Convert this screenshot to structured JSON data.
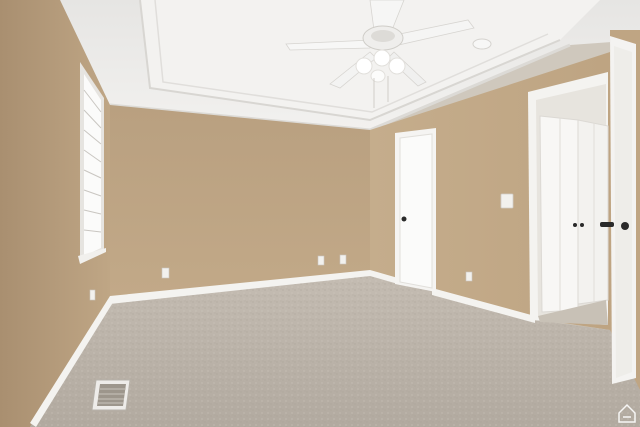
{
  "scene": {
    "kind": "photo",
    "subject": "empty-bedroom",
    "colors": {
      "wall_left": "#b59c7c",
      "wall_back": "#bea584",
      "wall_right": "#c3ab8b",
      "ceiling": "#ecebea",
      "trim": "#f4f3f0",
      "carpet": "#bdb5ab",
      "door": "#f5f4f2",
      "hardware": "#2a2a2a"
    },
    "icons": [
      "home-watermark-icon",
      "ceiling-fan-icon",
      "light-switch-icon",
      "outlet-icon",
      "floor-vent-icon",
      "smoke-detector-icon"
    ]
  }
}
